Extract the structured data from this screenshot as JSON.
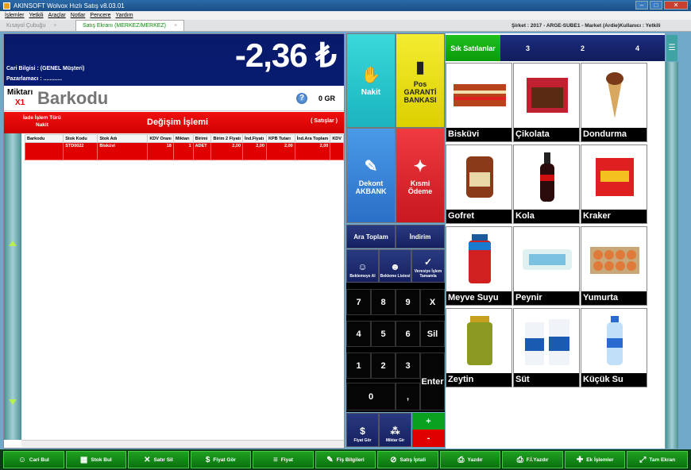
{
  "window": {
    "title": "AKINSOFT Wolvox Hızlı Satış v8.03.01"
  },
  "menu": [
    "İşlemler",
    "Yetkili",
    "Araçlar",
    "Notlar",
    "Pencere",
    "Yardım"
  ],
  "tabs": [
    {
      "label": "Kısayol Çubuğu"
    },
    {
      "label": "Satış Ekranı (MERKEZ/MERKEZ)"
    }
  ],
  "info": {
    "sirket": "Şirket : 2017 - ARGE-SUBE1 - Market (Ardie)",
    "kullanici": "Kullanıcı : Yetkili"
  },
  "header": {
    "amount": "-2,36 ₺",
    "cari": "Cari Bilgisi : (GENEL Müşteri)",
    "pazarlamaci": "Pazarlamacı : ............"
  },
  "barkod": {
    "miktar_label": "Miktarı",
    "miktar_value": "X1",
    "placeholder": "Barkodu",
    "weight": "0 GR"
  },
  "mode": {
    "iade_line1": "İade İşlem Türü",
    "iade_line2": "Nakit",
    "title": "Değişim İşlemi",
    "satislar": "( Satışlar )"
  },
  "table": {
    "columns": [
      "Barkodu",
      "Stok Kodu",
      "Stok Adı",
      "KDV Oranı",
      "Miktarı",
      "Birimi",
      "Birim 2 Fiyatı",
      "İnd.Fiyatı",
      "KPB Tutarı",
      "İnd.Ara Toplam",
      "KDV"
    ],
    "rows": [
      [
        "",
        "STD0022",
        "Bisküvi",
        "18",
        "1",
        "ADET",
        "2,00",
        "2,00",
        "2,00",
        "2,00",
        ""
      ]
    ]
  },
  "payments": {
    "nakit": "Nakit",
    "pos_line1": "Pos",
    "pos_line2": "GARANTİ",
    "pos_line3": "BANKASI",
    "dekont_line1": "Dekont",
    "dekont_line2": "AKBANK",
    "kismi_line1": "Kısmi",
    "kismi_line2": "Ödeme",
    "ara_toplam": "Ara Toplam",
    "indirim": "İndirim",
    "bekle_al": "Beklemeye Al",
    "bekleme_listesi": "Bekleme Listesi",
    "veresiye": "Veresiye İşlem Tamamla",
    "fiyat_gor": "Fiyat Gör",
    "miktar_gir": "Miktar Gir"
  },
  "keypad": [
    "7",
    "8",
    "9",
    "X",
    "4",
    "5",
    "6",
    "Sil",
    "1",
    "2",
    "3",
    "Enter",
    "0",
    ","
  ],
  "plus": "+",
  "minus": "-",
  "right_tabs": [
    "Sık Satılanlar",
    "3",
    "2",
    "4"
  ],
  "products": [
    {
      "name": "Bisküvi",
      "icon": "biscuit-icon"
    },
    {
      "name": "Çikolata",
      "icon": "chocolate-icon"
    },
    {
      "name": "Dondurma",
      "icon": "icecream-icon"
    },
    {
      "name": "Gofret",
      "icon": "wafer-icon"
    },
    {
      "name": "Kola",
      "icon": "cola-icon"
    },
    {
      "name": "Kraker",
      "icon": "cracker-icon"
    },
    {
      "name": "Meyve Suyu",
      "icon": "juice-icon"
    },
    {
      "name": "Peynir",
      "icon": "cheese-icon"
    },
    {
      "name": "Yumurta",
      "icon": "egg-icon"
    },
    {
      "name": "Zeytin",
      "icon": "olive-icon"
    },
    {
      "name": "Süt",
      "icon": "milk-icon"
    },
    {
      "name": "Küçük Su",
      "icon": "water-icon"
    }
  ],
  "bottom": [
    "Cari Bul",
    "Stok Bul",
    "Satır Sil",
    "Fiyat Gör",
    "Fiyat",
    "Fiş Bilgileri",
    "Satış İptali",
    "Yazdır",
    "F.İ.Yazdır",
    "Ek İşlemler",
    "Tam Ekran"
  ]
}
